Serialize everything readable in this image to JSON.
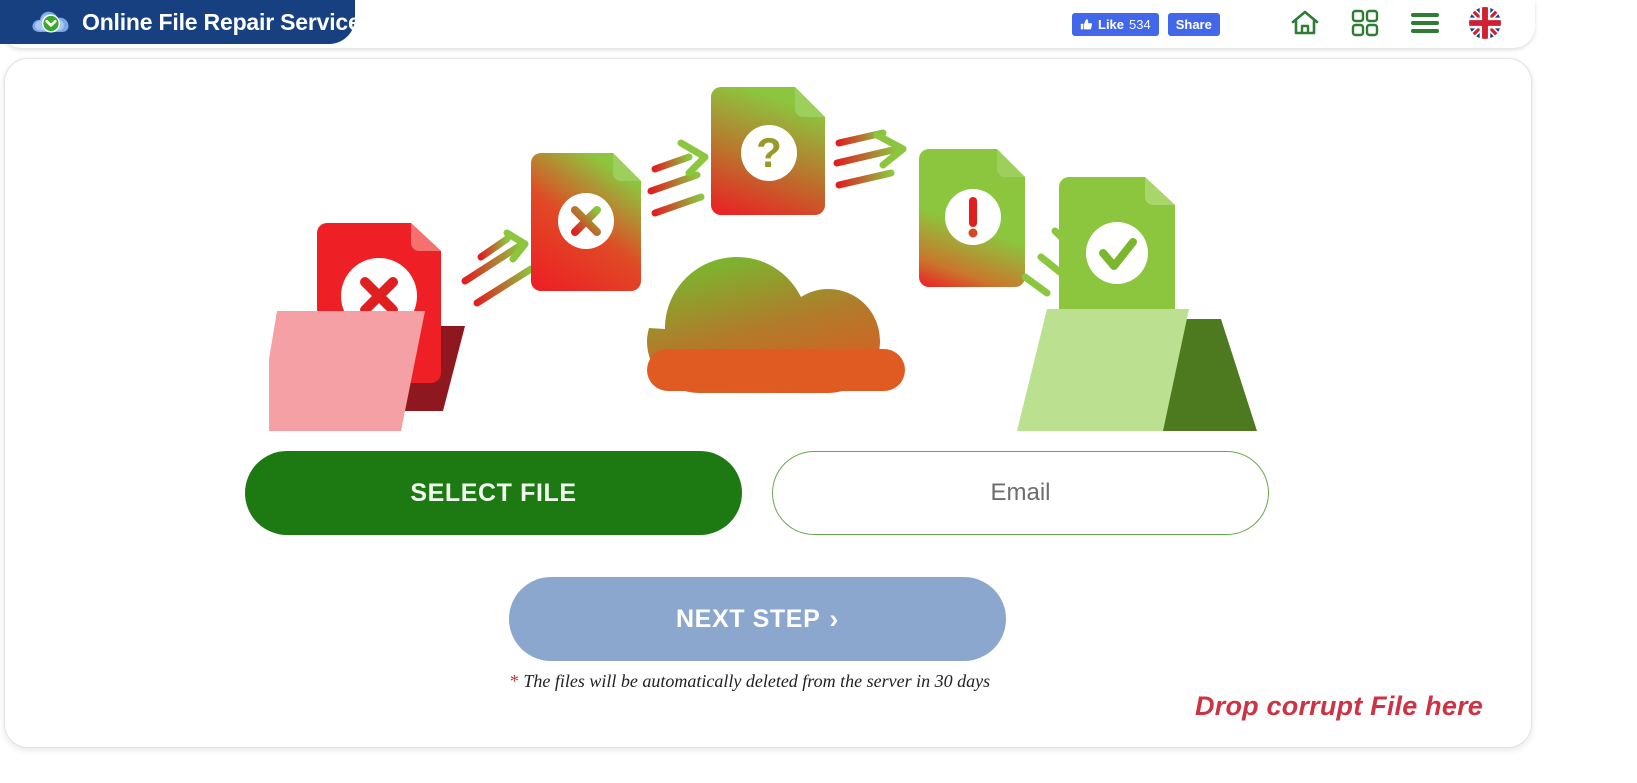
{
  "header": {
    "brand_title": "Online File Repair Service",
    "brand_logo_icon": "cloud-check-logo",
    "social": {
      "like_label": "Like",
      "like_count": "534",
      "like_icon": "thumbs-up-icon",
      "share_label": "Share"
    },
    "icons": [
      {
        "name": "home-icon",
        "label": "Home"
      },
      {
        "name": "grid-apps-icon",
        "label": "Apps"
      },
      {
        "name": "hamburger-menu-icon",
        "label": "Menu"
      },
      {
        "name": "uk-flag-icon",
        "label": "English"
      }
    ]
  },
  "main": {
    "illustration": {
      "name": "file-repair-flow-illustration",
      "nodes": [
        {
          "name": "corrupt-folder",
          "state": "error",
          "color": "#e8262a"
        },
        {
          "name": "error-document-x",
          "state": "error",
          "color": "#e8262a"
        },
        {
          "name": "gradient-document-x",
          "state": "processing",
          "color": "#e8262a"
        },
        {
          "name": "question-document",
          "state": "analyzing",
          "color": "#8cbf3f"
        },
        {
          "name": "cloud",
          "state": "processing",
          "color": "#d4622a"
        },
        {
          "name": "warning-document",
          "state": "repairing",
          "color": "#8cbf3f"
        },
        {
          "name": "repaired-document-check",
          "state": "success",
          "color": "#8cbf3f"
        },
        {
          "name": "repaired-folder",
          "state": "success",
          "color": "#b7dd8e"
        }
      ]
    },
    "select_file_label": "SELECT FILE",
    "email_placeholder": "Email",
    "email_value": "",
    "next_step_label": "NEXT STEP",
    "next_step_chevron": "›",
    "note_star": "*",
    "note_text": " The files will be automatically deleted from the server in 30 days",
    "drop_hint": "Drop corrupt File here"
  },
  "colors": {
    "brand_blue": "#16407f",
    "primary_green": "#1d7a12",
    "next_step_blue": "#8ba7cd",
    "drop_hint_red": "#cc3344",
    "facebook_blue": "#4267e8",
    "icon_green": "#2e7d32"
  }
}
